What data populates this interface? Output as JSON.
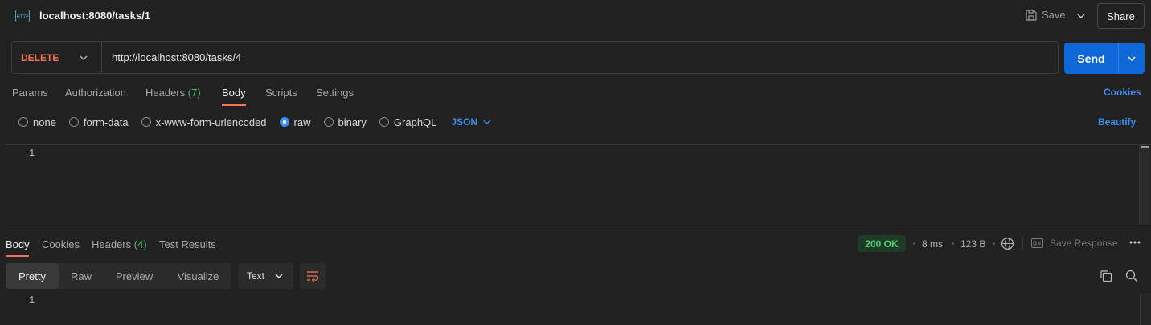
{
  "topbar": {
    "title": "localhost:8080/tasks/1",
    "save_label": "Save",
    "share_label": "Share",
    "icon": "http-icon"
  },
  "request": {
    "method": "DELETE",
    "url": "http://localhost:8080/tasks/4",
    "send_label": "Send",
    "tabs": [
      {
        "label": "Params"
      },
      {
        "label": "Authorization"
      },
      {
        "label": "Headers",
        "count": "(7)"
      },
      {
        "label": "Body"
      },
      {
        "label": "Scripts"
      },
      {
        "label": "Settings"
      }
    ],
    "active_tab": "Body",
    "cookies_label": "Cookies",
    "body_types": [
      "none",
      "form-data",
      "x-www-form-urlencoded",
      "raw",
      "binary",
      "GraphQL"
    ],
    "selected_body_type": "raw",
    "format": "JSON",
    "beautify_label": "Beautify",
    "editor_lines": [
      "1"
    ]
  },
  "response": {
    "tabs": [
      {
        "label": "Body"
      },
      {
        "label": "Cookies"
      },
      {
        "label": "Headers",
        "count": "(4)"
      },
      {
        "label": "Test Results"
      }
    ],
    "active_tab": "Body",
    "status": "200 OK",
    "time": "8 ms",
    "size": "123 B",
    "save_response_label": "Save Response",
    "views": [
      "Pretty",
      "Raw",
      "Preview",
      "Visualize"
    ],
    "active_view": "Pretty",
    "format": "Text",
    "editor_lines": [
      "1"
    ]
  },
  "colors": {
    "accent": "#f27157",
    "primary": "#0f68d7",
    "link": "#3b8ff0",
    "success": "#4fcf73"
  }
}
